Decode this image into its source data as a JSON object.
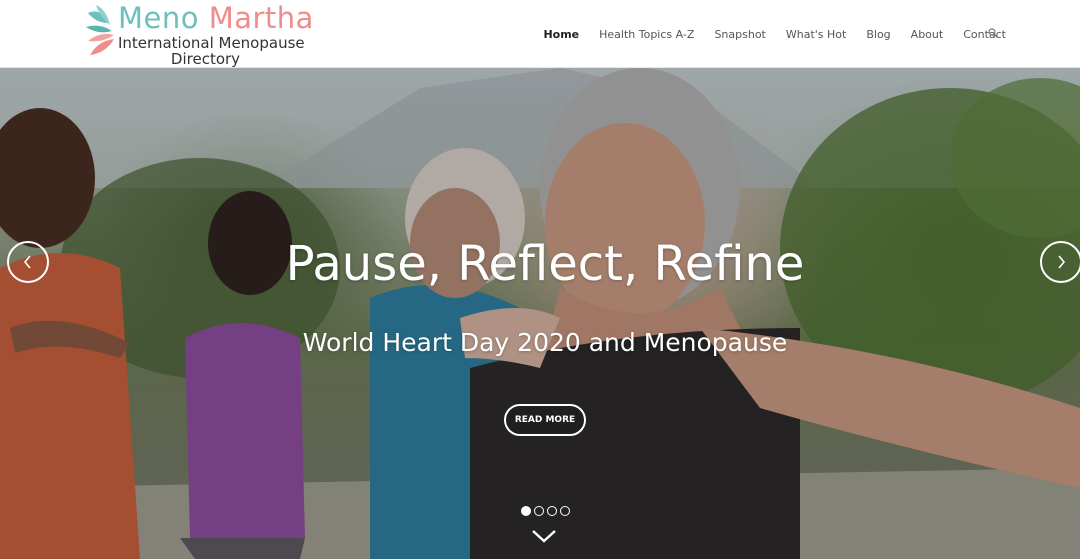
{
  "logo": {
    "line1_meno": "Meno",
    "line1_martha": "Martha",
    "line2": "International Menopause",
    "line3": "Directory",
    "colors": {
      "meno": "#6cc1bd",
      "martha": "#ef8c8c"
    }
  },
  "nav": {
    "items": [
      {
        "label": "Home",
        "active": true
      },
      {
        "label": "Health Topics A-Z"
      },
      {
        "label": "Snapshot"
      },
      {
        "label": "What's Hot"
      },
      {
        "label": "Blog"
      },
      {
        "label": "About"
      },
      {
        "label": "Contact"
      }
    ],
    "search_icon": "search-icon"
  },
  "hero": {
    "title": "Pause, Reflect, Refine",
    "subtitle": "World Heart Day 2020 and Menopause",
    "button": "READ MORE",
    "slides": 4,
    "active_slide": 1,
    "prev_icon": "chevron-left-icon",
    "next_icon": "chevron-right-icon",
    "scroll_icon": "chevron-down-icon"
  }
}
